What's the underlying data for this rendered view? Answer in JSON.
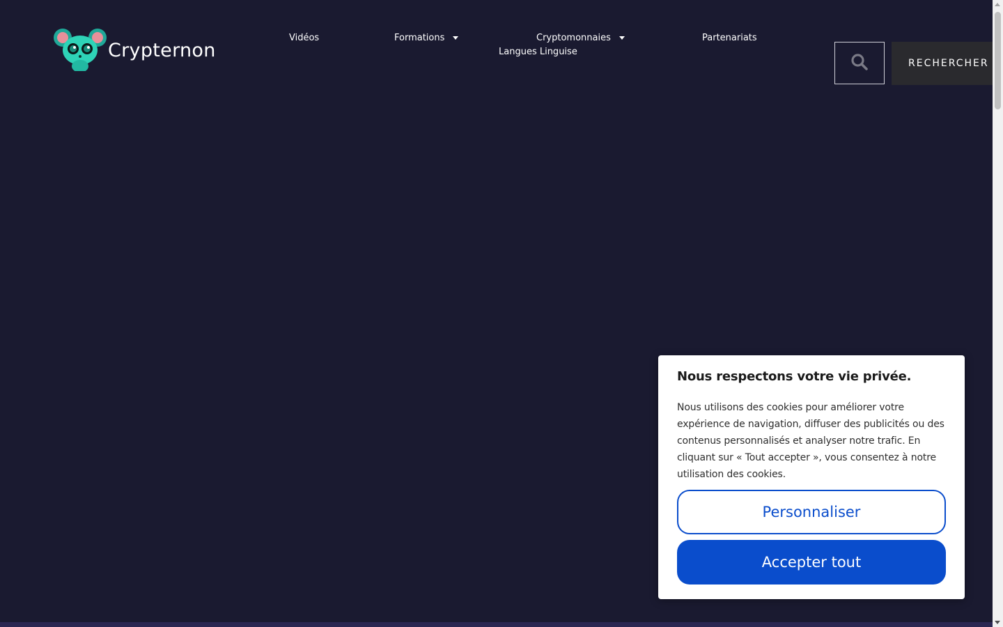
{
  "header": {
    "brand": "Crypternon",
    "nav": {
      "videos": "Vidéos",
      "formations": "Formations",
      "cryptomonnaies": "Cryptomonnaies",
      "partenariats": "Partenariats",
      "langues": "Langues Linguise"
    },
    "search_button": "RECHERCHER"
  },
  "cookie_banner": {
    "title": "Nous respectons votre vie privée.",
    "body": "Nous utilisons des cookies pour améliorer votre expérience de navigation, diffuser des publicités ou des contenus personnalisés et analyser notre trafic. En cliquant sur « Tout accepter », vous consentez à notre utilisation des cookies.",
    "customize_label": "Personnaliser",
    "accept_label": "Accepter tout"
  },
  "icons": {
    "logo": "mouse-mascot-icon",
    "search": "search-icon",
    "dropdown": "caret-down-icon"
  },
  "colors": {
    "background": "#1a1a30",
    "accent": "#0a4dcc",
    "search_button_bg": "#2a2a2e",
    "logo_teal": "#2ed3b7"
  }
}
